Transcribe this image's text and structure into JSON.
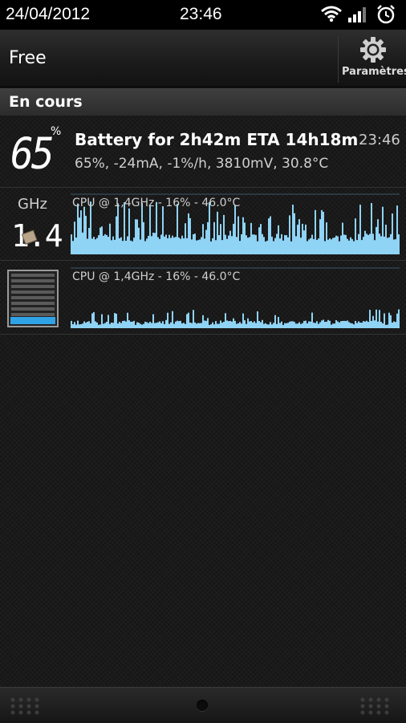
{
  "status_bar": {
    "date": "24/04/2012",
    "time": "23:46",
    "icons": [
      "wifi-icon",
      "signal-icon",
      "alarm-clock-icon"
    ]
  },
  "action_bar": {
    "title": "Free",
    "settings_label": "Paramètres",
    "settings_icon": "gear-icon"
  },
  "section": {
    "title": "En cours"
  },
  "battery_notification": {
    "level": "65",
    "level_unit": "%",
    "title": "Battery for 2h42m ETA 14h18m",
    "time": "23:46",
    "details": "65%, -24mA, -1%/h, 3810mV, 30.8°C"
  },
  "cpu_notification_1": {
    "unit": "GHz",
    "value": "1.4",
    "label": "CPU @ 1,4GHz - 16% - 46.0°C",
    "bar_color": "#8fd3f5"
  },
  "cpu_notification_2": {
    "label": "CPU @ 1,4GHz - 16% - 46.0°C",
    "level_fraction": 0.16,
    "bar_color": "#8fd3f5",
    "level_color": "#2fa3e6"
  }
}
